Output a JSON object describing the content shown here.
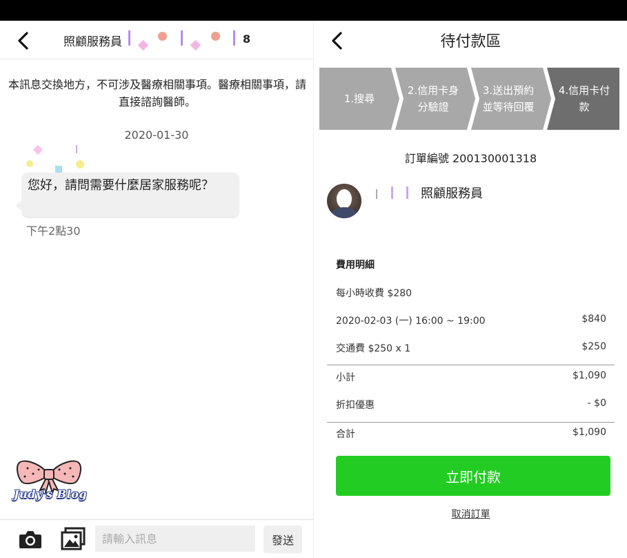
{
  "chat": {
    "header_name": "照顧服務員",
    "header_count": "8",
    "notice": "本訊息交換地方，不可涉及醫療相關事項。醫療相關事項，請直接諮詢醫師。",
    "date": "2020-01-30",
    "message": "您好，請問需要什麼居家服務呢？",
    "message_time": "下午2點30",
    "blog_name": "Judy's Blog",
    "input_placeholder": "請輸入訊息",
    "send_label": "發送"
  },
  "payment": {
    "title": "待付款區",
    "steps": [
      {
        "label": "1.搜尋",
        "active": false
      },
      {
        "label": "2.信用卡身分驗證",
        "active": false
      },
      {
        "label": "3.送出預約並等待回覆",
        "active": false
      },
      {
        "label": "4.信用卡付款",
        "active": true
      }
    ],
    "order_number": "訂單編號 200130001318",
    "caregiver_title": "照顧服務員",
    "fee_section_title": "費用明細",
    "hourly_rate": "每小時收費 $280",
    "items": [
      {
        "label": "2020-02-03 (一) 16:00 ~ 19:00",
        "amount": "$840"
      },
      {
        "label": "交通費 $250 x 1",
        "amount": "$250"
      }
    ],
    "subtotal_label": "小計",
    "subtotal_amount": "$1,090",
    "discount_label": "折扣優惠",
    "discount_amount": "- $0",
    "total_label": "合計",
    "total_amount": "$1,090",
    "pay_button": "立即付款",
    "cancel_link": "取消訂單"
  },
  "colors": {
    "step_inactive": "#a8a8a8",
    "step_active": "#6e6e6e",
    "pay_button": "#22cc22",
    "bubble": "#f0f0f0"
  },
  "icons": {
    "back": "chevron-left-icon",
    "camera": "camera-icon",
    "gallery": "image-gallery-icon"
  }
}
